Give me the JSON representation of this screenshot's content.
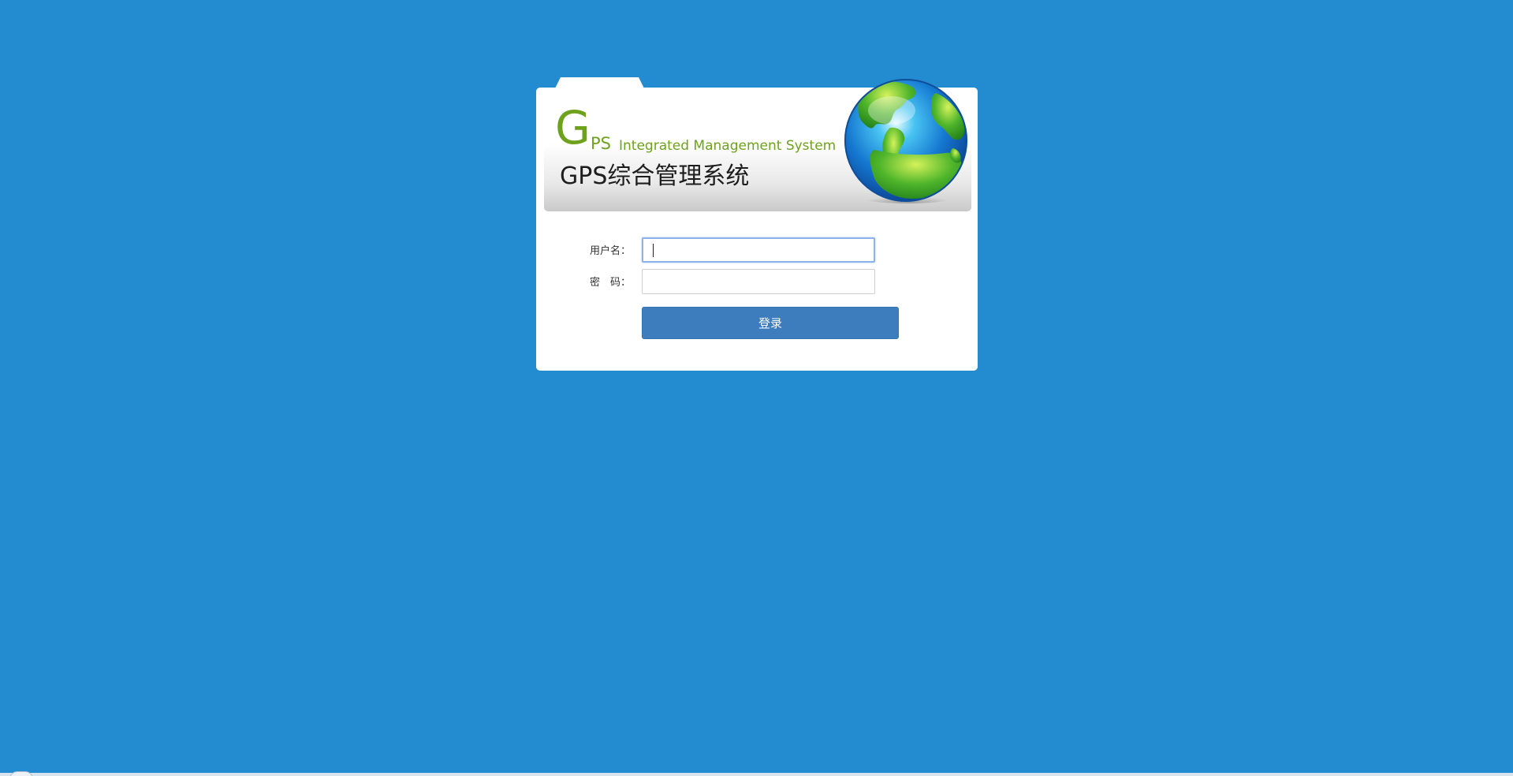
{
  "banner": {
    "logo_g": "G",
    "logo_ps": "PS",
    "subtitle_en": "Integrated Management System",
    "title_cn": "GPS综合管理系统",
    "globe_icon": "globe-icon"
  },
  "form": {
    "username_label": "用户名：",
    "username_value": "",
    "password_label": "密　码：",
    "password_value": "",
    "login_label": "登录"
  },
  "colors": {
    "background": "#238bcf",
    "brand_green": "#6fa21c",
    "button_blue": "#3d7dbd"
  }
}
